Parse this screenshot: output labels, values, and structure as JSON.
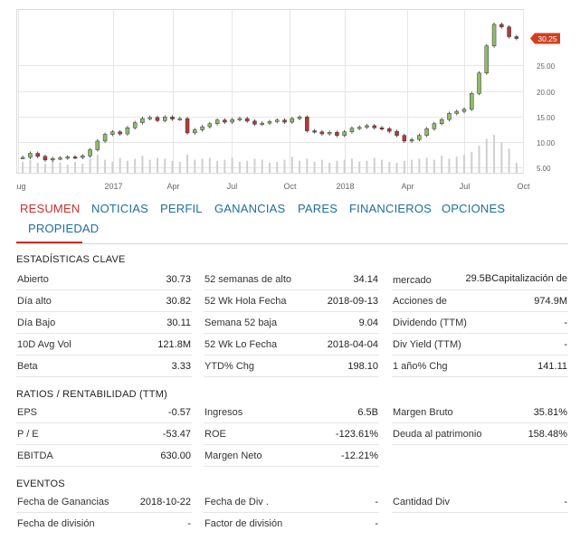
{
  "chart_data": {
    "type": "candlestick",
    "x_ticks": [
      "Aug",
      "2017",
      "Apr",
      "Jul",
      "Oct",
      "2018",
      "Apr",
      "Jul",
      "Oct"
    ],
    "y_ticks": [
      5.0,
      10.0,
      15.0,
      20.0,
      25.0
    ],
    "y_tick_labels": [
      "5.00",
      "10.00",
      "15.00",
      "20.00",
      "25.00"
    ],
    "ylim": [
      4,
      36
    ],
    "last_price_label": "30.25",
    "last_price": 30.25,
    "grid": true,
    "price_series": [
      7.0,
      7.8,
      7.2,
      6.5,
      6.8,
      6.9,
      7.1,
      7.0,
      7.3,
      8.5,
      10.2,
      11.5,
      12.0,
      11.6,
      12.8,
      13.8,
      14.6,
      14.8,
      14.2,
      14.9,
      14.5,
      14.6,
      11.8,
      12.4,
      13.0,
      13.6,
      14.3,
      13.9,
      14.4,
      14.6,
      14.1,
      13.5,
      13.7,
      14.0,
      14.3,
      13.9,
      14.6,
      14.9,
      12.2,
      12.0,
      11.6,
      11.9,
      11.3,
      12.0,
      12.7,
      12.9,
      13.2,
      12.8,
      12.6,
      12.1,
      11.3,
      10.2,
      10.5,
      11.3,
      12.6,
      13.6,
      14.4,
      15.6,
      16.0,
      16.4,
      19.5,
      23.5,
      28.8,
      33.0,
      32.5,
      30.6,
      30.25
    ],
    "volume_series": [
      2.2,
      2.6,
      2.0,
      1.8,
      2.4,
      2.0,
      1.6,
      2.2,
      1.8,
      2.8,
      3.6,
      2.6,
      2.2,
      3.0,
      2.4,
      2.8,
      3.4,
      2.6,
      3.0,
      2.8,
      2.4,
      2.2,
      3.6,
      2.6,
      2.8,
      3.0,
      2.4,
      2.6,
      3.0,
      2.2,
      2.4,
      2.8,
      2.6,
      2.0,
      2.2,
      2.6,
      3.2,
      2.4,
      2.8,
      2.2,
      2.6,
      2.0,
      2.4,
      2.6,
      2.8,
      2.2,
      2.4,
      3.0,
      2.6,
      2.2,
      2.0,
      2.4,
      2.6,
      2.8,
      3.0,
      2.6,
      3.4,
      2.8,
      3.2,
      3.6,
      4.2,
      5.4,
      6.8,
      7.6,
      6.0,
      4.8,
      2.0
    ],
    "colors": {
      "up": "#8fbc6a",
      "down": "#b23a3a",
      "volume": "#cfcfcf",
      "grid": "#e6e6e6",
      "price_tag": "#d0401f"
    }
  },
  "tabs": [
    {
      "label": "RESUMEN",
      "active": true
    },
    {
      "label": "NOTICIAS",
      "active": false
    },
    {
      "label": "PERFIL",
      "active": false
    },
    {
      "label": "GANANCIAS",
      "active": false
    },
    {
      "label": "PARES",
      "active": false
    },
    {
      "label": "FINANCIEROS",
      "active": false
    },
    {
      "label": "OPCIONES",
      "active": false
    },
    {
      "label": "PROPIEDAD",
      "active": false
    }
  ],
  "key_stats": {
    "title": "ESTADÍSTICAS CLAVE",
    "col1": [
      {
        "label": "Abierto",
        "value": "30.73"
      },
      {
        "label": "Día alto",
        "value": "30.82"
      },
      {
        "label": "Día Bajo",
        "value": "30.11"
      },
      {
        "label": "10D Avg Vol",
        "value": "121.8M"
      },
      {
        "label": "Beta",
        "value": "3.33"
      }
    ],
    "col2": [
      {
        "label": "52 semanas de alto",
        "value": "34.14"
      },
      {
        "label": "52 Wk Hola Fecha",
        "value": "2018-09-13"
      },
      {
        "label": "Semana 52 baja",
        "value": "9.04"
      },
      {
        "label": "52 Wk Lo Fecha",
        "value": "2018-04-04"
      },
      {
        "label": "YTD% Chg",
        "value": "198.10"
      }
    ],
    "col3": [
      {
        "label": "mercado",
        "value": "29.5BCapitalización de"
      },
      {
        "label": "Acciones de",
        "value": "974.9M"
      },
      {
        "label": "Dividendo (TTM)",
        "value": "-"
      },
      {
        "label": "Div Yield (TTM)",
        "value": "-"
      },
      {
        "label": "1 año% Chg",
        "value": "141.11"
      }
    ]
  },
  "ratios": {
    "title": "RATIOS / RENTABILIDAD (TTM)",
    "col1": [
      {
        "label": "EPS",
        "value": "-0.57"
      },
      {
        "label": "P / E",
        "value": "-53.47"
      },
      {
        "label": "EBITDA",
        "value": "630.00"
      }
    ],
    "col2": [
      {
        "label": "Ingresos",
        "value": "6.5B"
      },
      {
        "label": "ROE",
        "value": "-123.61%"
      },
      {
        "label": "Margen Neto",
        "value": "-12.21%"
      }
    ],
    "col3": [
      {
        "label": "Margen Bruto",
        "value": "35.81%"
      },
      {
        "label": "Deuda al patrimonio",
        "value": "158.48%"
      }
    ]
  },
  "events": {
    "title": "EVENTOS",
    "col1": [
      {
        "label": "Fecha de Ganancias",
        "value": "2018-10-22"
      },
      {
        "label": "Fecha de división",
        "value": "-"
      }
    ],
    "col2": [
      {
        "label": "Fecha de Div .",
        "value": "-"
      },
      {
        "label": "Factor de división",
        "value": "-"
      }
    ],
    "col3": [
      {
        "label": "Cantidad Div",
        "value": "-"
      }
    ]
  }
}
